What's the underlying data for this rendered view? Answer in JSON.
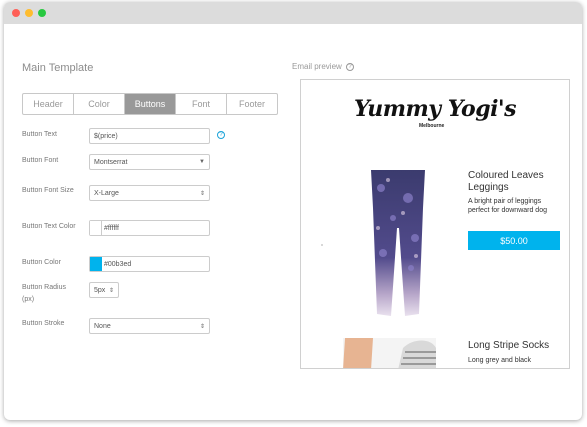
{
  "section_title": "Main Template",
  "tabs": [
    {
      "label": "Header"
    },
    {
      "label": "Color"
    },
    {
      "label": "Buttons",
      "active": true
    },
    {
      "label": "Font"
    },
    {
      "label": "Footer"
    }
  ],
  "form": {
    "button_text": {
      "label": "Button Text",
      "value": "$(price)"
    },
    "button_font": {
      "label": "Button Font",
      "value": "Montserrat"
    },
    "button_font_size": {
      "label": "Button Font Size",
      "value": "X-Large"
    },
    "button_text_color": {
      "label": "Button Text Color",
      "value": "#ffffff"
    },
    "button_color": {
      "label": "Button Color",
      "value": "#00b3ed"
    },
    "button_radius": {
      "label": "Button Radius (px)",
      "value": "5px"
    },
    "button_stroke": {
      "label": "Button Stroke",
      "value": "None"
    }
  },
  "help_icon": "?",
  "preview": {
    "label": "Email preview",
    "info_icon": "?",
    "brand": "Yummy Yogi's",
    "brand_sub": "Melbourne",
    "products": [
      {
        "title": "Coloured Leaves Leggings",
        "description": "A bright pair of leggings perfect for downward dog",
        "price": "$50.00"
      },
      {
        "title": "Long Stripe Socks",
        "description": "Long grey and black"
      }
    ]
  },
  "colors": {
    "accent": "#00b3ed",
    "tab_active": "#999999"
  },
  "icons": {
    "help": "question-circle-icon",
    "info": "info-circle-icon",
    "caret": "chevron-down-icon"
  }
}
